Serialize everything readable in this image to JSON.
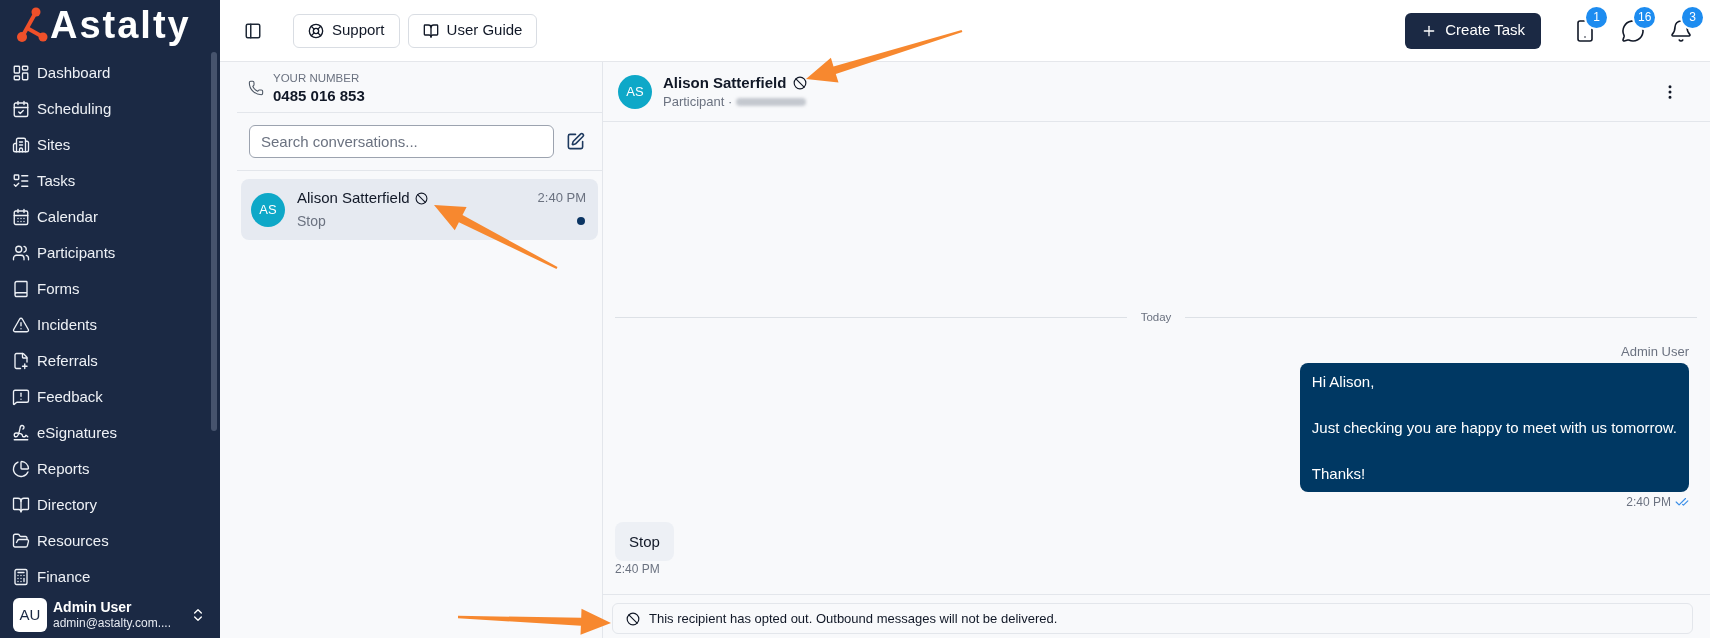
{
  "sidebar": {
    "logo": "Astalty",
    "items": [
      {
        "label": "Dashboard",
        "selected": false
      },
      {
        "label": "Scheduling",
        "selected": false
      },
      {
        "label": "Sites",
        "selected": false
      },
      {
        "label": "Tasks",
        "selected": false
      },
      {
        "label": "Calendar",
        "selected": false
      },
      {
        "label": "Participants",
        "selected": false
      },
      {
        "label": "Forms",
        "selected": false
      },
      {
        "label": "Incidents",
        "selected": false
      },
      {
        "label": "Referrals",
        "selected": false
      },
      {
        "label": "Feedback",
        "selected": false
      },
      {
        "label": "eSignatures",
        "selected": false
      },
      {
        "label": "Reports",
        "selected": false
      },
      {
        "label": "Directory",
        "selected": false
      },
      {
        "label": "Resources",
        "selected": false
      },
      {
        "label": "Finance",
        "selected": false
      }
    ],
    "user": {
      "initials": "AU",
      "name": "Admin User",
      "email": "admin@astalty.com...."
    }
  },
  "topbar": {
    "buttons": [
      {
        "label": "Support"
      },
      {
        "label": "User Guide"
      }
    ],
    "primary_button": "Create Task",
    "notifications": [
      {
        "count": "1"
      },
      {
        "count": "16"
      },
      {
        "count": "3"
      }
    ]
  },
  "conversation_list": {
    "number_label": "YOUR NUMBER",
    "number": "0485 016 853",
    "search": {
      "placeholder": "Search conversations..."
    },
    "items": [
      {
        "initials": "AS",
        "name": "Alison Satterfield",
        "opted_out": true,
        "time": "2:40 PM",
        "preview": "Stop",
        "unread": true,
        "selected": true
      }
    ]
  },
  "chat": {
    "contact": {
      "initials": "AS",
      "name": "Alison Satterfield",
      "opted_out": true,
      "subtitle": "Participant ·"
    },
    "date_divider": "Today",
    "messages": [
      {
        "kind": "outbound",
        "sender": "Admin User",
        "text": "Hi Alison,\n\nJust checking you are happy to meet with us tomorrow.\n\nThanks!",
        "time": "2:40 PM",
        "read": true
      },
      {
        "kind": "inbound",
        "text": "Stop",
        "time": "2:40 PM"
      }
    ],
    "notice": "This recipient has opted out. Outbound messages will not be delivered."
  }
}
